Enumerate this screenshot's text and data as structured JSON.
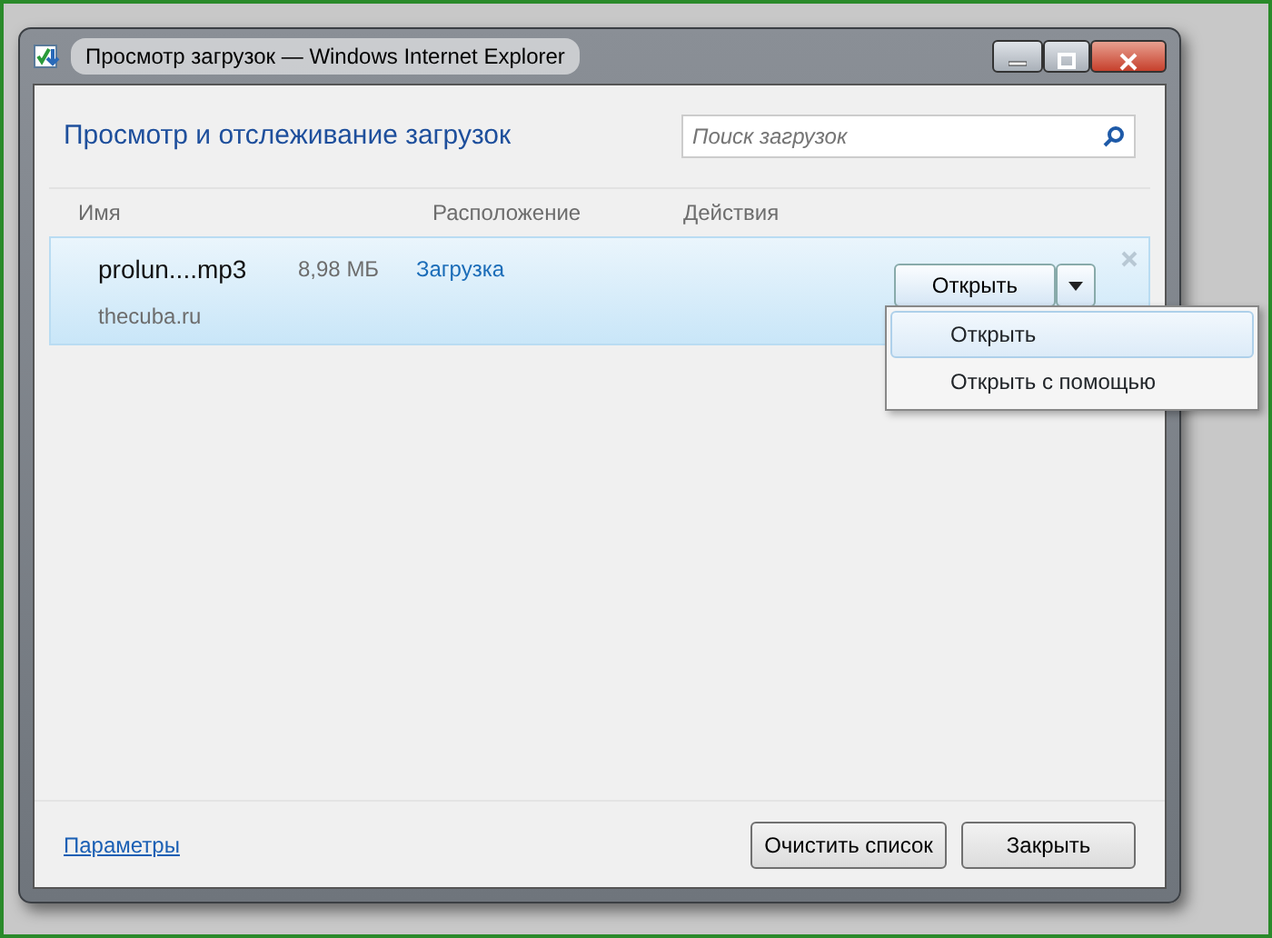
{
  "window": {
    "title": "Просмотр загрузок — Windows Internet Explorer"
  },
  "heading": "Просмотр и отслеживание загрузок",
  "search": {
    "placeholder": "Поиск загрузок"
  },
  "columns": [
    "Имя",
    "Расположение",
    "Действия"
  ],
  "downloads": [
    {
      "name": "prolun....mp3",
      "size": "8,98 МБ",
      "source": "thecuba.ru",
      "location": "Загрузка",
      "action": "Открыть",
      "selected": true
    }
  ],
  "menu": [
    {
      "label": "Открыть",
      "selected": true
    },
    {
      "label": "Открыть с помощью",
      "selected": false
    }
  ],
  "footer": {
    "link": "Параметры",
    "buttons": [
      "Очистить список",
      "Закрыть"
    ]
  }
}
